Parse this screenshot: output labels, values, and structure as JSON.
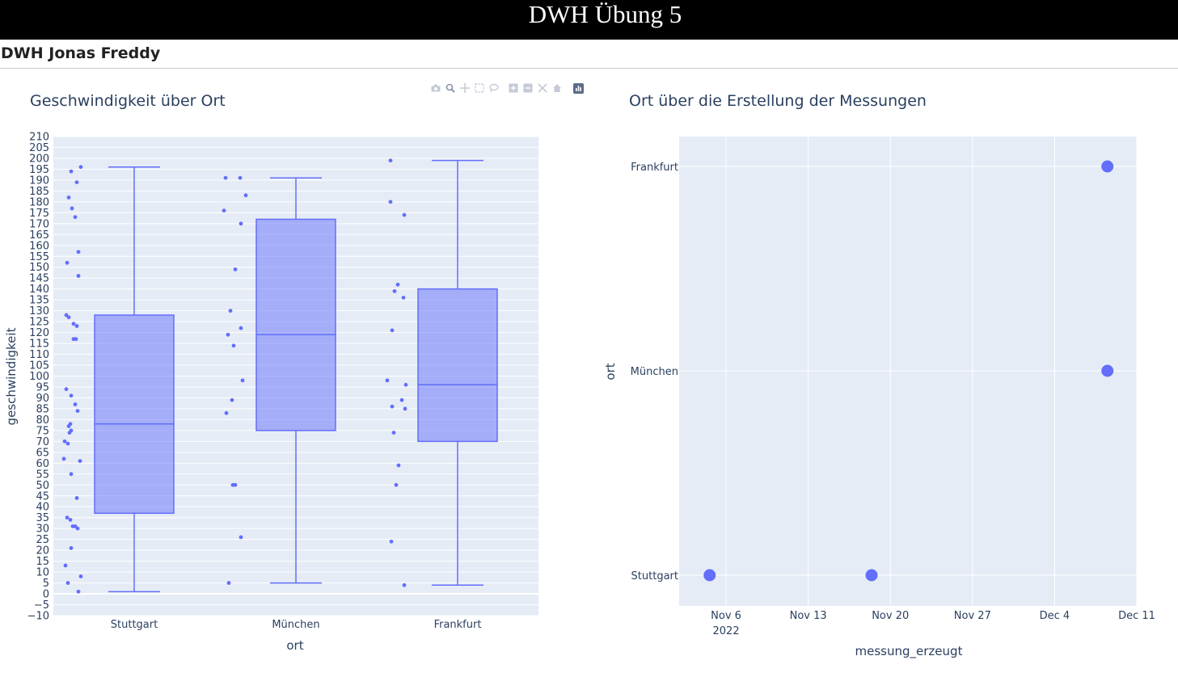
{
  "header": {
    "title": "DWH Übung 5",
    "subtitle": "DWH Jonas Freddy"
  },
  "modebar": {
    "icons": [
      "camera-icon",
      "zoom-icon",
      "pan-icon",
      "box-select-icon",
      "lasso-select-icon",
      "zoom-in-icon",
      "zoom-out-icon",
      "autoscale-icon",
      "reset-axes-icon",
      "plotly-logo-icon"
    ]
  },
  "colors": {
    "trace": "#636efa",
    "box_fill": "rgba(99,110,250,0.5)",
    "plot_bg": "#e5ecf6",
    "text": "#2a3f5f"
  },
  "chart_data": [
    {
      "type": "box",
      "title": "Geschwindigkeit über Ort",
      "xlabel": "ort",
      "ylabel": "geschwindigkeit",
      "categories": [
        "Stuttgart",
        "München",
        "Frankfurt"
      ],
      "ylim": [
        -10,
        210
      ],
      "y_ticks": [
        -10,
        -5,
        0,
        5,
        10,
        15,
        20,
        25,
        30,
        35,
        40,
        45,
        50,
        55,
        60,
        65,
        70,
        75,
        80,
        85,
        90,
        95,
        100,
        105,
        110,
        115,
        120,
        125,
        130,
        135,
        140,
        145,
        150,
        155,
        160,
        165,
        170,
        175,
        180,
        185,
        190,
        195,
        200,
        205,
        210
      ],
      "boxes": [
        {
          "name": "Stuttgart",
          "min": 1,
          "q1": 37,
          "median": 78,
          "q3": 128,
          "max": 196
        },
        {
          "name": "München",
          "min": 5,
          "q1": 75,
          "median": 119,
          "q3": 172,
          "max": 191
        },
        {
          "name": "Frankfurt",
          "min": 4,
          "q1": 70,
          "median": 96,
          "q3": 140,
          "max": 199
        }
      ],
      "points": [
        [
          194,
          196,
          189,
          182,
          177,
          173,
          157,
          152,
          146,
          128,
          127,
          124,
          123,
          117,
          117,
          94,
          91,
          87,
          84,
          78,
          77,
          75,
          74,
          70,
          69,
          62,
          61,
          55,
          44,
          35,
          34,
          31,
          31,
          30,
          21,
          13,
          8,
          5,
          1
        ],
        [
          191,
          191,
          183,
          176,
          170,
          149,
          130,
          122,
          119,
          114,
          98,
          89,
          83,
          50,
          50,
          26,
          5
        ],
        [
          199,
          180,
          174,
          142,
          139,
          136,
          121,
          98,
          96,
          89,
          86,
          85,
          74,
          59,
          50,
          24,
          4
        ]
      ],
      "points_offset": [
        [
          -78,
          -66,
          -71,
          -81,
          -77,
          -73,
          -69,
          -83,
          -69,
          -84,
          -81,
          -75,
          -71,
          -75,
          -72,
          -84,
          -78,
          -73,
          -70,
          -79,
          -81,
          -78,
          -80,
          -86,
          -82,
          -87,
          -67,
          -78,
          -71,
          -83,
          -79,
          -76,
          -73,
          -70,
          -78,
          -85,
          -66,
          -82,
          -69
        ],
        [
          -87,
          -69,
          -62,
          -89,
          -68,
          -75,
          -81,
          -68,
          -84,
          -77,
          -66,
          -79,
          -86,
          -78,
          -75,
          -68,
          -83
        ],
        [
          -83,
          -83,
          -66,
          -74,
          -78,
          -67,
          -81,
          -87,
          -64,
          -69,
          -81,
          -65,
          -79,
          -73,
          -76,
          -82,
          -66
        ]
      ]
    },
    {
      "type": "scatter",
      "title": "Ort über die Erstellung der Messungen",
      "xlabel": "messung_erzeugt",
      "ylabel": "ort",
      "categories": [
        "Stuttgart",
        "München",
        "Frankfurt"
      ],
      "x_ticks": [
        "Nov 6",
        "Nov 13",
        "Nov 20",
        "Nov 27",
        "Dec 4",
        "Dec 11"
      ],
      "x_tick_days": [
        0,
        7,
        14,
        21,
        28,
        35
      ],
      "x_year_label": "2022",
      "xlim_days": [
        -4,
        35
      ],
      "points": [
        {
          "x": "2022-11-04",
          "x_day": -1.4,
          "y": "Stuttgart"
        },
        {
          "x": "2022-11-18",
          "x_day": 12.4,
          "y": "Stuttgart"
        },
        {
          "x": "2022-12-09",
          "x_day": 32.5,
          "y": "München"
        },
        {
          "x": "2022-12-09",
          "x_day": 32.5,
          "y": "Frankfurt"
        }
      ]
    }
  ]
}
